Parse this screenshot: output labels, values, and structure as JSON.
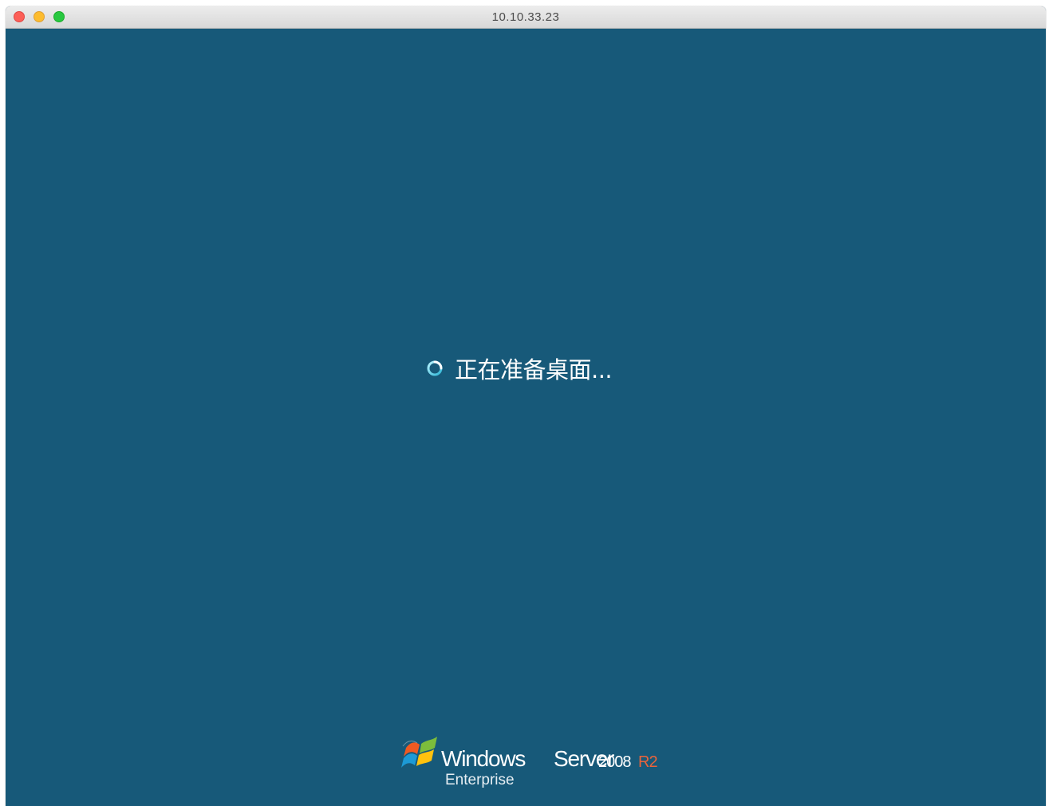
{
  "window": {
    "title": "10.10.33.23"
  },
  "screen": {
    "background_color": "#175979",
    "status_text": "正在准备桌面...",
    "spinner_icon": "spinner-icon"
  },
  "branding": {
    "windows": "Windows",
    "server": "Server",
    "version": "2008",
    "release": "R2",
    "edition": "Enterprise",
    "logo_icon": "windows-flag-icon",
    "release_color": "#e8643c"
  }
}
